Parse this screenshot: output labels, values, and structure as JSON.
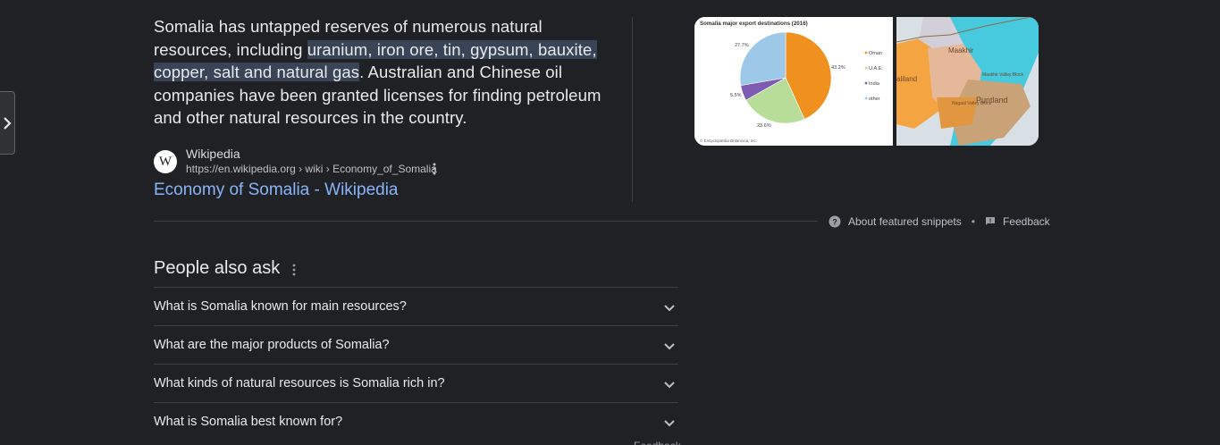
{
  "snippet": {
    "text_before": "Somalia has untapped reserves of numerous natural resources, including ",
    "text_highlight": "uranium, iron ore, tin, gypsum, bauxite, copper, salt and natural gas",
    "text_after": ". Australian and Chinese oil companies have been granted licenses for finding petroleum and other natural resources in the country."
  },
  "source": {
    "favicon_letter": "W",
    "name": "Wikipedia",
    "url": "https://en.wikipedia.org › wiki › Economy_of_Somalia",
    "link_title": "Economy of Somalia - Wikipedia"
  },
  "images": {
    "pie": {
      "title": "Somalia major export destinations (2016)",
      "labels": [
        "27.7%",
        "43.2%",
        "5.5%",
        "23.6%"
      ],
      "legend": [
        "Oman",
        "U.A.E.",
        "India",
        "other"
      ],
      "legend_colors": [
        "#f0901e",
        "#b7dd99",
        "#7d5cb2",
        "#9dc8e8"
      ],
      "credit": "© Encyclopædia Britannica, Inc.",
      "chart_data": {
        "type": "pie",
        "title": "Somalia major export destinations (2016)",
        "categories": [
          "Oman",
          "U.A.E.",
          "India",
          "other"
        ],
        "values": [
          43.2,
          23.6,
          5.5,
          27.7
        ],
        "colors": [
          "#f0901e",
          "#b7dd99",
          "#7d5cb2",
          "#9dc8e8"
        ],
        "legend_position": "right"
      }
    },
    "map": {
      "labels": [
        "Maakhir",
        "aliland",
        "Puntland",
        "Maakhir Valley Block",
        "Nugaal Valley Block"
      ]
    }
  },
  "footer": {
    "about": "About featured snippets",
    "separator": "•",
    "feedback": "Feedback"
  },
  "paa": {
    "title": "People also ask",
    "questions": [
      "What is Somalia known for main resources?",
      "What are the major products of Somalia?",
      "What kinds of natural resources is Somalia rich in?",
      "What is Somalia best known for?"
    ],
    "cutoff": "Feedback"
  },
  "colors": {
    "background": "#202124",
    "link": "#8ab4f8",
    "highlight": "#394457"
  }
}
